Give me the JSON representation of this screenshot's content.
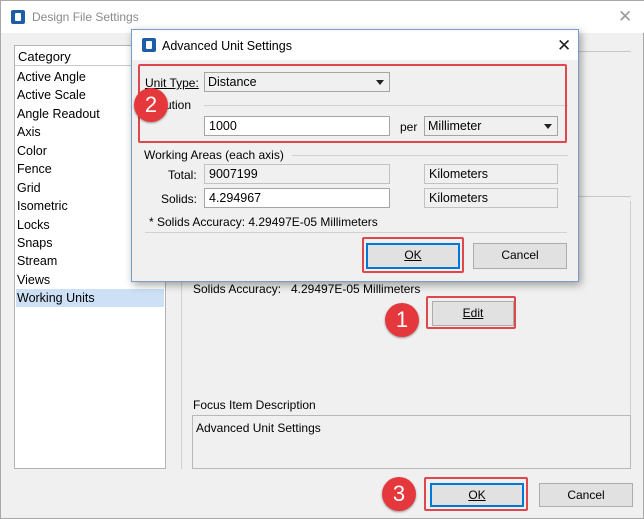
{
  "main_window": {
    "title": "Design File Settings",
    "close_glyph": "✕"
  },
  "category": {
    "header": "Category",
    "items": [
      "Active Angle",
      "Active Scale",
      "Angle Readout",
      "Axis",
      "Color",
      "Fence",
      "Grid",
      "Isometric",
      "Locks",
      "Snaps",
      "Stream",
      "Views",
      "Working Units"
    ],
    "selected": "Working Units"
  },
  "right_pane": {
    "solids_accuracy_label": "Solids Accuracy:",
    "solids_accuracy_value": "4.29497E-05 Millimeters",
    "edit_label": "Edit",
    "focus_label": "Focus Item Description",
    "focus_text": "Advanced Unit Settings"
  },
  "footer": {
    "ok_label": "OK",
    "cancel_label": "Cancel"
  },
  "dialog": {
    "title": "Advanced Unit Settings",
    "close_glyph": "✕",
    "unit_type_label": "Unit Type:",
    "unit_type_value": "Distance",
    "resolution_label": "ution",
    "resolution_value": "1000",
    "per_label": "per",
    "per_unit_value": "Millimeter",
    "working_areas_label": "Working Areas (each axis)",
    "total_label": "Total:",
    "total_value": "9007199",
    "total_unit": "Kilometers",
    "solids_label": "Solids:",
    "solids_value": "4.294967",
    "solids_unit": "Kilometers",
    "solids_accuracy_note": "* Solids Accuracy: 4.29497E-05 Millimeters",
    "ok_label": "OK",
    "cancel_label": "Cancel"
  },
  "annotations": {
    "badge_1": "1",
    "badge_2": "2",
    "badge_3": "3",
    "highlight_color": "#e0474c",
    "badge_color": "#e5383d"
  },
  "colors": {
    "selection": "#cde0f5",
    "default_button_border": "#0078d7",
    "app_icon": "#1e5ea8"
  }
}
